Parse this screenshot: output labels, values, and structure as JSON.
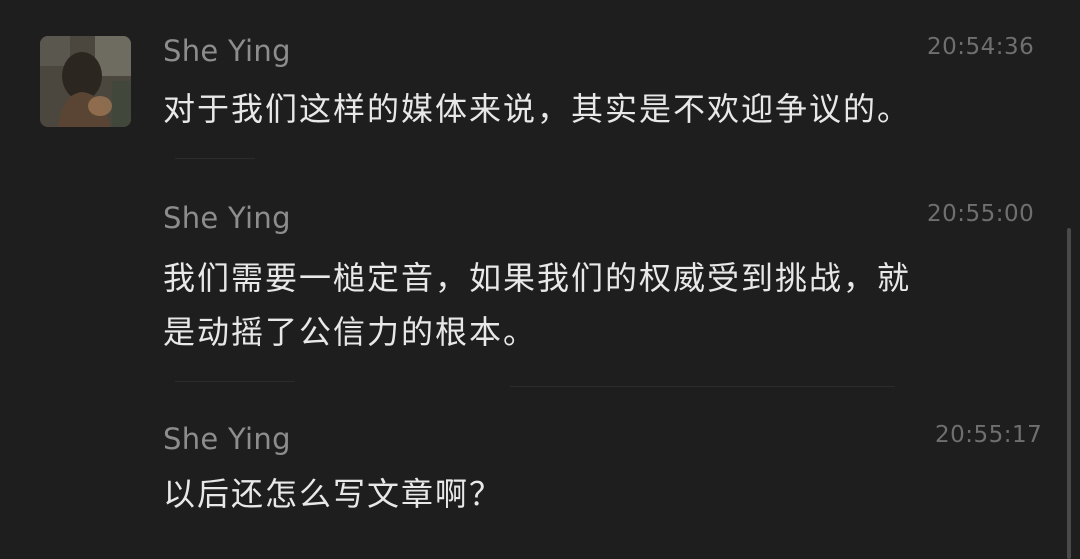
{
  "messages": [
    {
      "sender": "She Ying",
      "time": "20:54:36",
      "lines": [
        "对于我们这样的媒体来说，其实是不欢迎争议的。"
      ]
    },
    {
      "sender": "She Ying",
      "time": "20:55:00",
      "lines": [
        "我们需要一槌定音，如果我们的权威受到挑战，就",
        "是动摇了公信力的根本。"
      ]
    },
    {
      "sender": "She Ying",
      "time": "20:55:17",
      "lines": [
        "以后还怎么写文章啊？"
      ]
    }
  ]
}
